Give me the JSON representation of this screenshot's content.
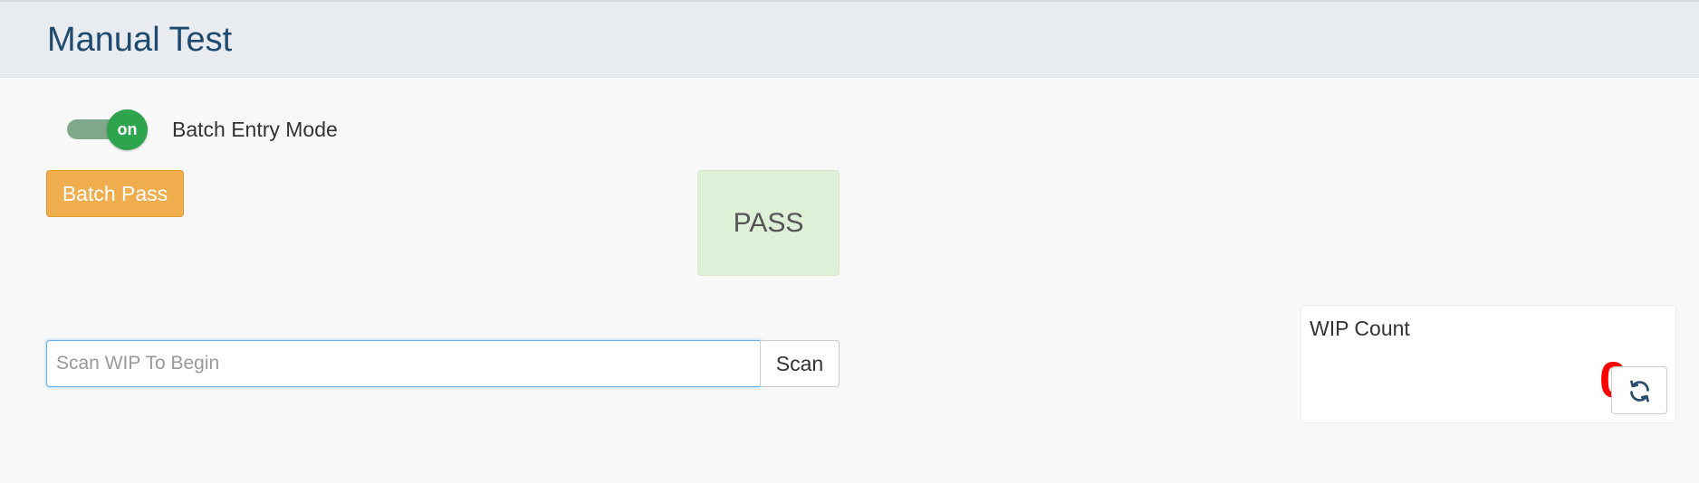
{
  "header": {
    "title": "Manual Test"
  },
  "batch_mode": {
    "toggle_state_label": "on",
    "label": "Batch Entry Mode",
    "enabled": true
  },
  "actions": {
    "batch_pass_label": "Batch Pass"
  },
  "result": {
    "status": "PASS"
  },
  "scan": {
    "placeholder": "Scan WIP To Begin",
    "value": "",
    "button_label": "Scan"
  },
  "wip": {
    "title": "WIP Count",
    "count": "0",
    "refresh_icon": "refresh-icon"
  },
  "colors": {
    "title": "#1f4a6e",
    "toggle_on": "#2ea44f",
    "batch_pass": "#f0ad4e",
    "pass_bg": "#dff0d8",
    "wip_count": "#ff0000"
  }
}
